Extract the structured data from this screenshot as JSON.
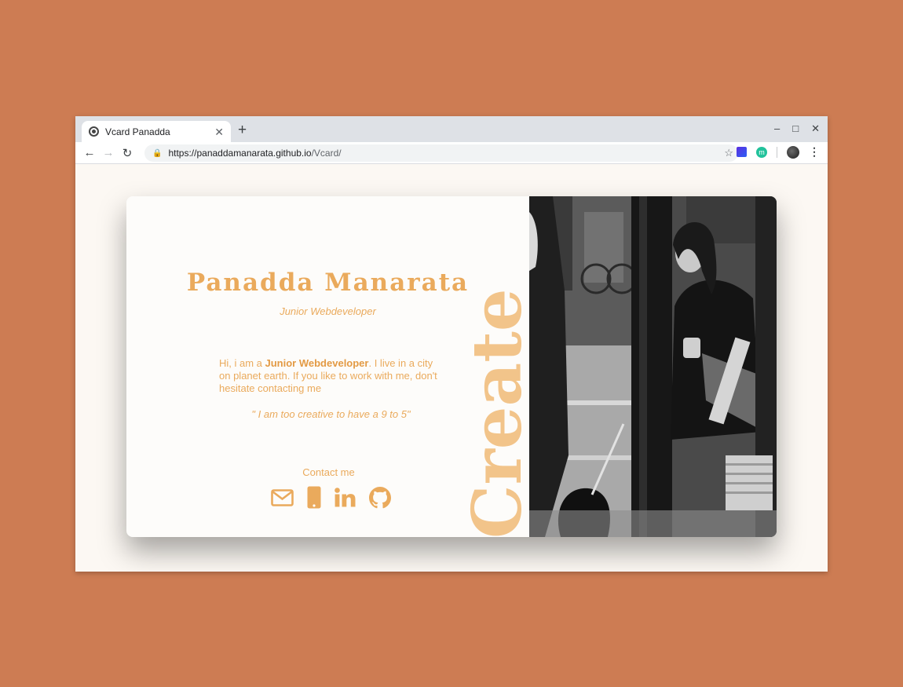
{
  "browser": {
    "tab_title": "Vcard Panadda",
    "url_host": "https://panaddamanarata.github.io",
    "url_path": "/Vcard/",
    "extension_label": "m"
  },
  "card": {
    "name": "Panadda Manarata",
    "role": "Junior Webdeveloper",
    "bio_before": "Hi, i am a ",
    "bio_highlight": "Junior Webdeveloper",
    "bio_after": ". I live in a city on planet earth. If you like to work with me, don't hesitate contacting me",
    "quote": "\" I am too creative to have a 9 to 5\"",
    "contact_label": "Contact me",
    "vertical_word": "Create",
    "contact_icons": [
      "envelope-icon",
      "phone-icon",
      "linkedin-icon",
      "github-icon"
    ]
  },
  "colors": {
    "accent": "#eaaa5c",
    "background": "#cd7c53",
    "page": "#fcf8f3"
  }
}
